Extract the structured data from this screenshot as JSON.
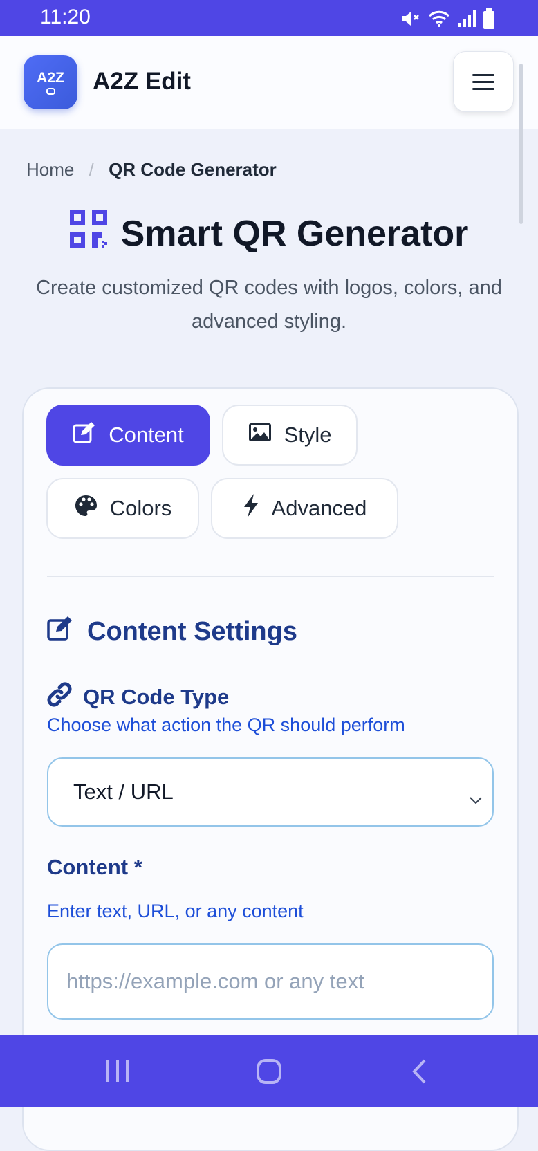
{
  "status_bar": {
    "time": "11:20",
    "icons": [
      "mute-icon",
      "wifi-icon",
      "signal-icon",
      "battery-icon"
    ]
  },
  "header": {
    "logo_text": "A2Z",
    "brand": "A2Z Edit",
    "menu_icon": "hamburger-icon"
  },
  "breadcrumb": {
    "home": "Home",
    "separator": "/",
    "current": "QR Code Generator"
  },
  "hero": {
    "title": "Smart QR Generator",
    "subtitle": "Create customized QR codes with logos, colors, and advanced styling."
  },
  "tabs": [
    {
      "label": "Content",
      "icon": "edit-icon",
      "active": true
    },
    {
      "label": "Style",
      "icon": "image-icon",
      "active": false
    },
    {
      "label": "Colors",
      "icon": "palette-icon",
      "active": false
    },
    {
      "label": "Advanced",
      "icon": "bolt-icon",
      "active": false
    }
  ],
  "content_settings": {
    "title": "Content Settings",
    "qr_type": {
      "label": "QR Code Type",
      "hint": "Choose what action the QR should perform",
      "selected": "Text / URL"
    },
    "content": {
      "label": "Content *",
      "hint": "Enter text, URL, or any content",
      "value": "",
      "placeholder": "https://example.com or any text"
    }
  },
  "colors": {
    "accent": "#4f46e5",
    "heading": "#1e3a8a",
    "hint": "#1d4ed8",
    "field_border": "#93c5e9"
  },
  "nav_bar": {
    "items": [
      "recent-apps-icon",
      "home-icon",
      "back-icon"
    ]
  }
}
